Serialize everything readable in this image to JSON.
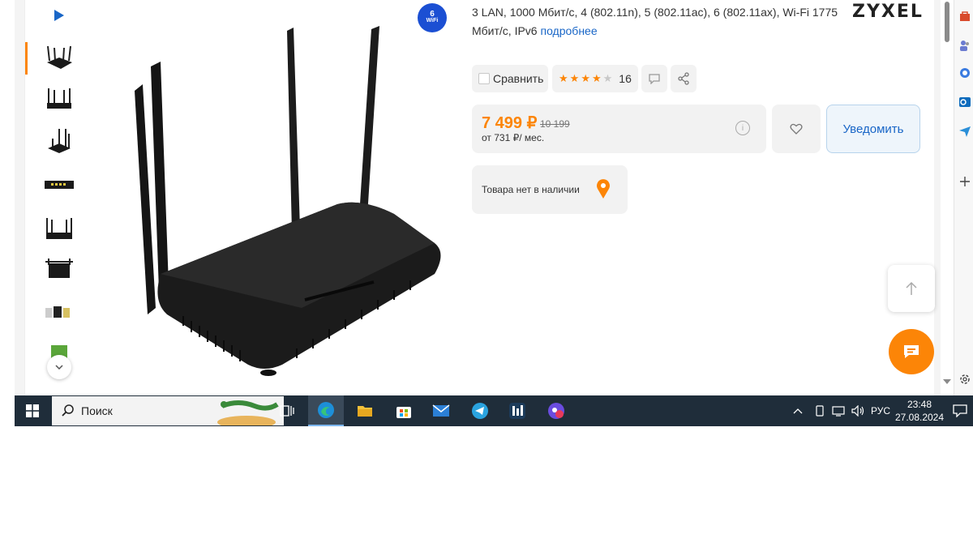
{
  "product": {
    "spec_text": "3 LAN, 1000 Мбит/с, 4 (802.11n), 5 (802.11ac), 6 (802.11ax), Wi-Fi 1775 Мбит/с, IPv6",
    "spec_more_link": "подробнее",
    "brand": "ZYXEL",
    "wifi_badge_number": "6",
    "wifi_badge_text": "WiFi"
  },
  "actions": {
    "compare_label": "Сравнить",
    "rating_count": "16",
    "rating_stars": 4
  },
  "price": {
    "current": "7 499 ₽",
    "old": "10 199",
    "credit": "от 731 ₽/ мес."
  },
  "buttons": {
    "notify_label": "Уведомить"
  },
  "stock": {
    "status": "Товара нет в наличии"
  },
  "taskbar": {
    "search_label": "Поиск",
    "language": "РУС",
    "time": "23:48",
    "date": "27.08.2024"
  },
  "colors": {
    "accent": "#fc8507",
    "link": "#1966c7",
    "taskbar": "#1f2d3a"
  }
}
